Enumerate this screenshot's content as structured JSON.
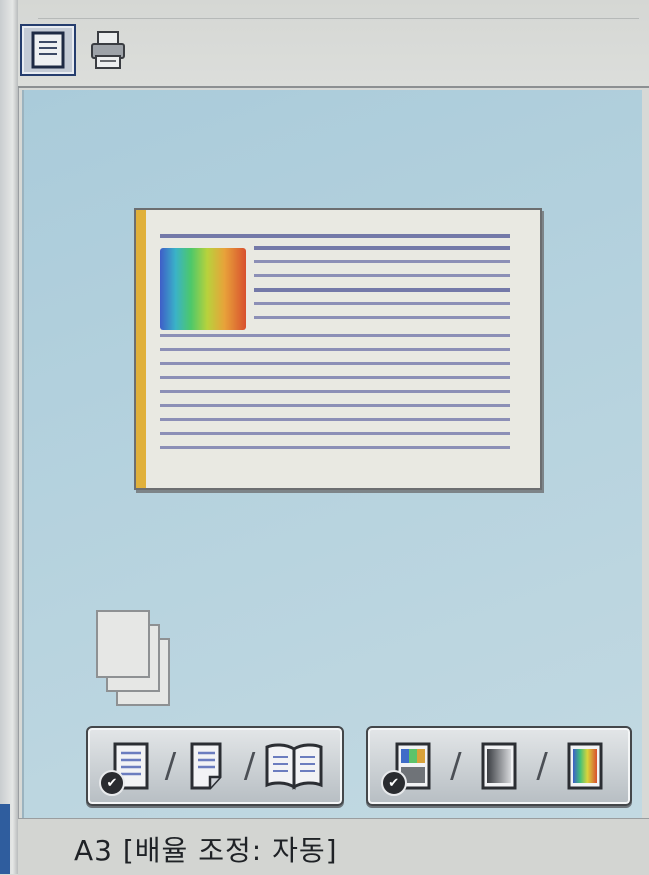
{
  "toolbar": {
    "views": [
      {
        "name": "page-preview-icon",
        "active": true
      },
      {
        "name": "printer-view-icon",
        "active": false
      }
    ]
  },
  "preview": {
    "binding_color": "#e0b03a",
    "gradient_thumbnail": true
  },
  "print_options": {
    "layout_group": [
      {
        "name": "single-sided-icon",
        "selected": true
      },
      {
        "name": "double-sided-icon",
        "selected": false
      },
      {
        "name": "booklet-icon",
        "selected": false
      }
    ],
    "color_group": [
      {
        "name": "auto-color-icon",
        "selected": true
      },
      {
        "name": "grayscale-icon",
        "selected": false
      },
      {
        "name": "full-color-icon",
        "selected": false
      }
    ],
    "separator": "/"
  },
  "status": {
    "text": "A3 [배율 조정: 자동]"
  }
}
